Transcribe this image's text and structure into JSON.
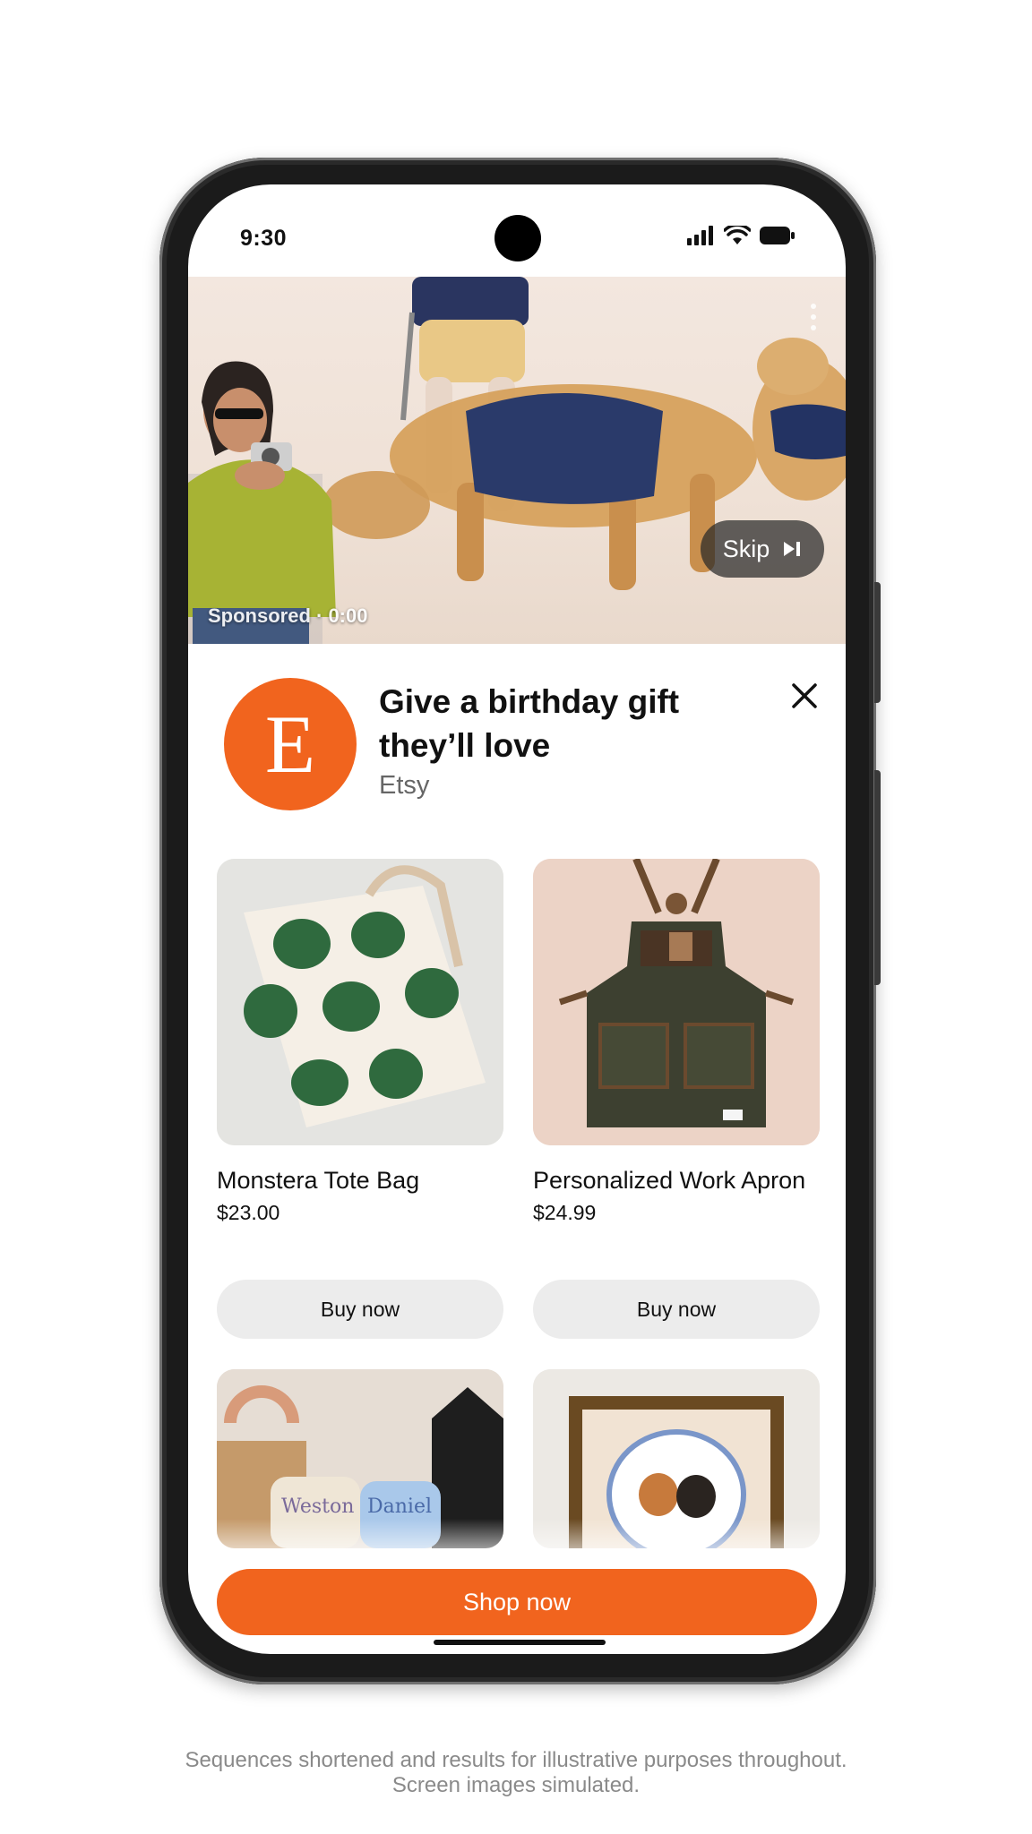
{
  "status_bar": {
    "time": "9:30"
  },
  "video": {
    "sponsored_label": "Sponsored · 0:00",
    "skip_label": "Skip"
  },
  "ad": {
    "title": "Give a birthday gift they’ll love",
    "brand": "Etsy",
    "logo_letter": "E",
    "brand_color": "#F1641E"
  },
  "products": [
    {
      "name": "Monstera Tote Bag",
      "price": "$23.00",
      "button_label": "Buy now"
    },
    {
      "name": "Personalized Work Apron",
      "price": "$24.99",
      "button_label": "Buy now"
    }
  ],
  "partial_products": [
    {
      "image_text_1": "Weston",
      "image_text_2": "Daniel"
    },
    {}
  ],
  "cta": {
    "label": "Shop now"
  },
  "disclaimer": {
    "line1": "Sequences shortened and results for illustrative purposes throughout.",
    "line2": "Screen images simulated."
  },
  "icons": [
    "signal-icon",
    "wifi-icon",
    "battery-icon",
    "skip-next-icon",
    "close-icon",
    "more-vert-icon"
  ]
}
